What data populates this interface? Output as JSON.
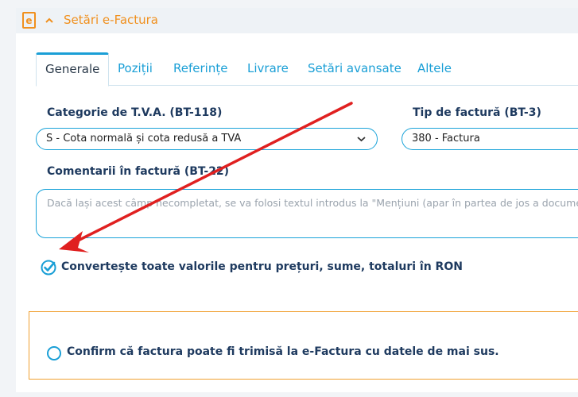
{
  "panel": {
    "icon_letter": "e",
    "title": "Setări e-Factura"
  },
  "tabs": [
    {
      "label": "Generale",
      "active": true
    },
    {
      "label": "Poziții",
      "active": false
    },
    {
      "label": "Referințe",
      "active": false
    },
    {
      "label": "Livrare",
      "active": false
    },
    {
      "label": "Setări avansate",
      "active": false
    },
    {
      "label": "Altele",
      "active": false
    }
  ],
  "vat_category": {
    "label": "Categorie de T.V.A. (BT-118)",
    "value": "S - Cota normală și cota redusă a TVA"
  },
  "invoice_type": {
    "label": "Tip de factură (BT-3)",
    "value": "380 - Factura"
  },
  "comments": {
    "label": "Comentarii în factură (BT-22)",
    "placeholder": "Dacă lași acest câmp necompletat, se va folosi textul introdus la \"Mențiuni (apar în partea de jos a documentului)\""
  },
  "convert_checkbox": {
    "label": "Convertește toate valorile pentru prețuri, sume, totaluri în RON",
    "checked": true
  },
  "confirm_radio": {
    "label": "Confirm că factura poate fi trimisă la e-Factura cu datele de mai sus.",
    "checked": false
  },
  "colors": {
    "accent_orange": "#f0901e",
    "accent_blue": "#1a9fd6",
    "label_navy": "#1e3a5f",
    "annotation_arrow": "#e02020"
  }
}
